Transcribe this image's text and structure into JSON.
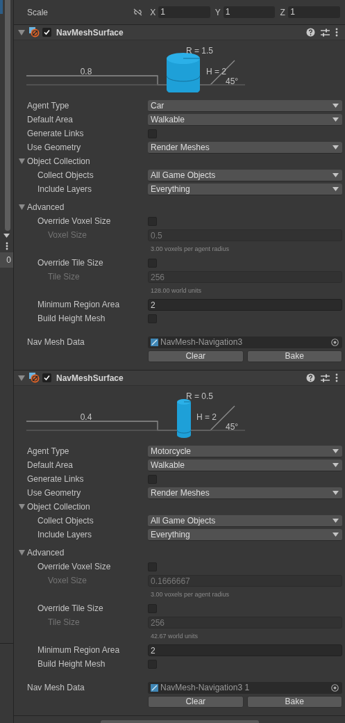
{
  "side_panel": {
    "count": "0"
  },
  "transform": {
    "label": "Scale",
    "axes": [
      {
        "axis": "X",
        "value": "1"
      },
      {
        "axis": "Y",
        "value": "1"
      },
      {
        "axis": "Z",
        "value": "1"
      }
    ]
  },
  "components": [
    {
      "title": "NavMeshSurface",
      "expanded": true,
      "enabled": true,
      "diagram": {
        "kind": "wide",
        "step": "0.8",
        "radius": "R = 1.5",
        "height": "H = 2",
        "slope": "45°"
      },
      "properties": [
        {
          "kind": "dropdown",
          "label": "Agent Type",
          "value": "Car"
        },
        {
          "kind": "dropdown",
          "label": "Default Area",
          "value": "Walkable"
        },
        {
          "kind": "checkbox",
          "label": "Generate Links",
          "checked": false
        },
        {
          "kind": "dropdown",
          "label": "Use Geometry",
          "value": "Render Meshes"
        },
        {
          "kind": "group",
          "label": "Object Collection",
          "expanded": true,
          "children": [
            {
              "kind": "dropdown",
              "label": "Collect Objects",
              "value": "All Game Objects"
            },
            {
              "kind": "dropdown",
              "label": "Include Layers",
              "value": "Everything"
            }
          ]
        },
        {
          "kind": "group",
          "label": "Advanced",
          "expanded": true,
          "children": [
            {
              "kind": "checkbox",
              "label": "Override Voxel Size",
              "checked": false,
              "children": [
                {
                  "kind": "number",
                  "label": "Voxel Size",
                  "value": "0.5",
                  "disabled": true
                }
              ]
            },
            {
              "kind": "note",
              "text": "3.00 voxels per agent radius"
            },
            {
              "kind": "checkbox",
              "label": "Override Tile Size",
              "checked": false,
              "children": [
                {
                  "kind": "number",
                  "label": "Tile Size",
                  "value": "256",
                  "disabled": true
                }
              ]
            },
            {
              "kind": "note",
              "text": "128.00 world units"
            },
            {
              "kind": "number",
              "label": "Minimum Region Area",
              "value": "2",
              "disabled": false
            },
            {
              "kind": "checkbox",
              "label": "Build Height Mesh",
              "checked": false
            }
          ]
        },
        {
          "kind": "object",
          "label": "Nav Mesh Data",
          "value": "NavMesh-Navigation3"
        }
      ],
      "buttons": [
        "Clear",
        "Bake"
      ]
    },
    {
      "title": "NavMeshSurface",
      "expanded": true,
      "enabled": true,
      "diagram": {
        "kind": "narrow",
        "step": "0.4",
        "radius": "R = 0.5",
        "height": "H = 2",
        "slope": "45°"
      },
      "properties": [
        {
          "kind": "dropdown",
          "label": "Agent Type",
          "value": "Motorcycle"
        },
        {
          "kind": "dropdown",
          "label": "Default Area",
          "value": "Walkable"
        },
        {
          "kind": "checkbox",
          "label": "Generate Links",
          "checked": false
        },
        {
          "kind": "dropdown",
          "label": "Use Geometry",
          "value": "Render Meshes"
        },
        {
          "kind": "group",
          "label": "Object Collection",
          "expanded": true,
          "children": [
            {
              "kind": "dropdown",
              "label": "Collect Objects",
              "value": "All Game Objects"
            },
            {
              "kind": "dropdown",
              "label": "Include Layers",
              "value": "Everything"
            }
          ]
        },
        {
          "kind": "group",
          "label": "Advanced",
          "expanded": true,
          "children": [
            {
              "kind": "checkbox",
              "label": "Override Voxel Size",
              "checked": false,
              "children": [
                {
                  "kind": "number",
                  "label": "Voxel Size",
                  "value": "0.1666667",
                  "disabled": true
                }
              ]
            },
            {
              "kind": "note",
              "text": "3.00 voxels per agent radius"
            },
            {
              "kind": "checkbox",
              "label": "Override Tile Size",
              "checked": false,
              "children": [
                {
                  "kind": "number",
                  "label": "Tile Size",
                  "value": "256",
                  "disabled": true
                }
              ]
            },
            {
              "kind": "note",
              "text": "42.67 world units"
            },
            {
              "kind": "number",
              "label": "Minimum Region Area",
              "value": "2",
              "disabled": false
            },
            {
              "kind": "checkbox",
              "label": "Build Height Mesh",
              "checked": false
            }
          ]
        },
        {
          "kind": "object",
          "label": "Nav Mesh Data",
          "value": "NavMesh-Navigation3 1"
        }
      ],
      "buttons": [
        "Clear",
        "Bake"
      ]
    }
  ]
}
